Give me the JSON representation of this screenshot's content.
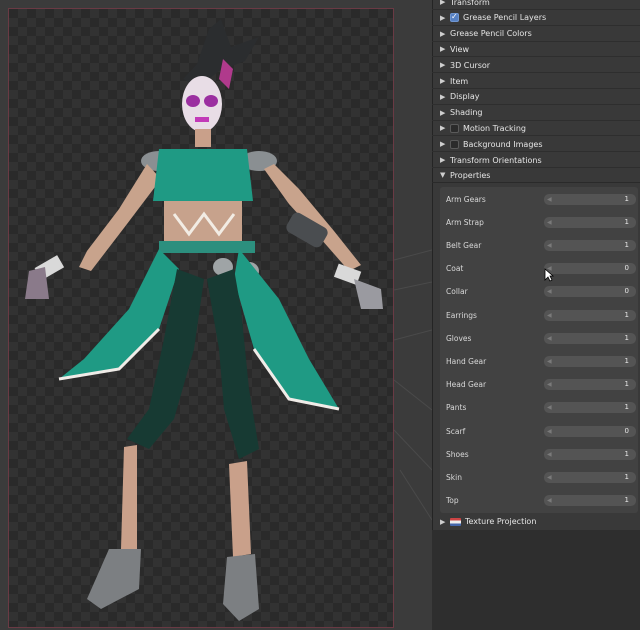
{
  "panel": {
    "sections_top": [
      {
        "label": "Transform",
        "checkbox": null
      },
      {
        "label": "Grease Pencil Layers",
        "checkbox": "on"
      },
      {
        "label": "Grease Pencil Colors",
        "checkbox": null
      },
      {
        "label": "View",
        "checkbox": null
      },
      {
        "label": "3D Cursor",
        "checkbox": null
      },
      {
        "label": "Item",
        "checkbox": null
      },
      {
        "label": "Display",
        "checkbox": null
      },
      {
        "label": "Shading",
        "checkbox": null
      },
      {
        "label": "Motion Tracking",
        "checkbox": "off"
      },
      {
        "label": "Background Images",
        "checkbox": "off"
      },
      {
        "label": "Transform Orientations",
        "checkbox": null
      }
    ],
    "properties_header": "Properties",
    "properties": [
      {
        "label": "Arm Gears",
        "value": "1"
      },
      {
        "label": "Arm Strap",
        "value": "1"
      },
      {
        "label": "Belt Gear",
        "value": "1"
      },
      {
        "label": "Coat",
        "value": "0"
      },
      {
        "label": "Collar",
        "value": "0"
      },
      {
        "label": "Earrings",
        "value": "1"
      },
      {
        "label": "Gloves",
        "value": "1"
      },
      {
        "label": "Hand Gear",
        "value": "1"
      },
      {
        "label": "Head Gear",
        "value": "1"
      },
      {
        "label": "Pants",
        "value": "1"
      },
      {
        "label": "Scarf",
        "value": "0"
      },
      {
        "label": "Shoes",
        "value": "1"
      },
      {
        "label": "Skin",
        "value": "1"
      },
      {
        "label": "Top",
        "value": "1"
      }
    ],
    "texture_projection": "Texture Projection",
    "icons": {
      "collapsed": "triangle-right-icon",
      "expanded": "triangle-down-icon",
      "texture": "texture-flag-icon"
    }
  },
  "colors": {
    "accent_check": "#5680c2",
    "outfit_teal": "#1f9a84",
    "makeup_magenta": "#c23ab8"
  }
}
